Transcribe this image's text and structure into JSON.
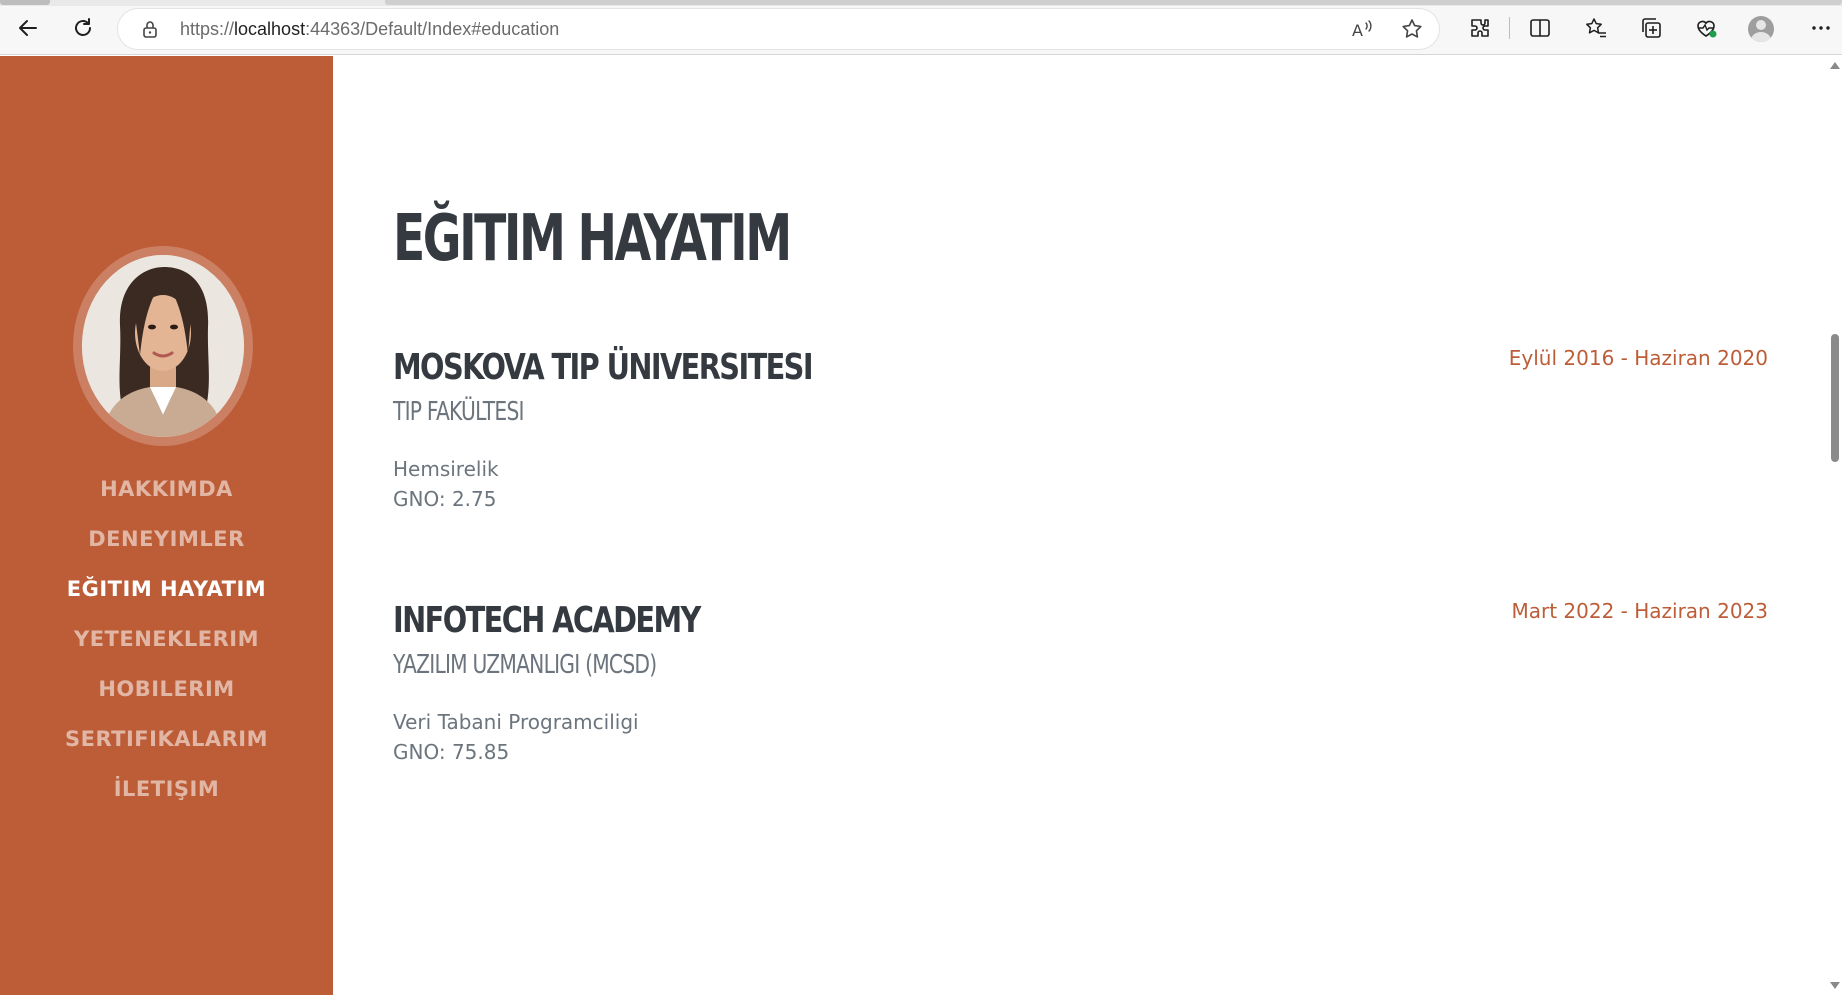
{
  "browser": {
    "url_protocol": "https://",
    "url_host": "localhost",
    "url_rest": ":44363/Default/Index#education",
    "icons": [
      "back-icon",
      "refresh-icon",
      "lock-icon",
      "read-aloud-icon",
      "favorite-star-icon",
      "extensions-icon",
      "split-screen-icon",
      "favorites-icon",
      "collections-icon",
      "browser-essentials-icon",
      "profile-icon",
      "more-icon"
    ]
  },
  "sidebar": {
    "background_color": "#bd5d38",
    "nav": [
      {
        "label": "HAKKIMDA",
        "active": false
      },
      {
        "label": "DENEYIMLER",
        "active": false
      },
      {
        "label": "EĞITIM HAYATIM",
        "active": true
      },
      {
        "label": "YETENEKLERIM",
        "active": false
      },
      {
        "label": "HOBILERIM",
        "active": false
      },
      {
        "label": "SERTIFIKALARIM",
        "active": false
      },
      {
        "label": "İLETIŞIM",
        "active": false
      }
    ]
  },
  "main": {
    "title": "EĞITIM HAYATIM",
    "education": [
      {
        "school": "MOSKOVA TIP ÜNIVERSITESI",
        "faculty": "TIP FAKÜLTESI",
        "department": "Hemsirelik",
        "gpa": "GNO: 2.75",
        "dates": "Eylül 2016 - Haziran 2020"
      },
      {
        "school": "INFOTECH ACADEMY",
        "faculty": "YAZILIM UZMANLIGI (MCSD)",
        "department": "Veri Tabani Programciligi",
        "gpa": "GNO: 75.85",
        "dates": "Mart 2022 - Haziran 2023"
      }
    ],
    "accent_color": "#bd5d38",
    "heading_color": "#343a40",
    "text_color": "#6c757d"
  }
}
